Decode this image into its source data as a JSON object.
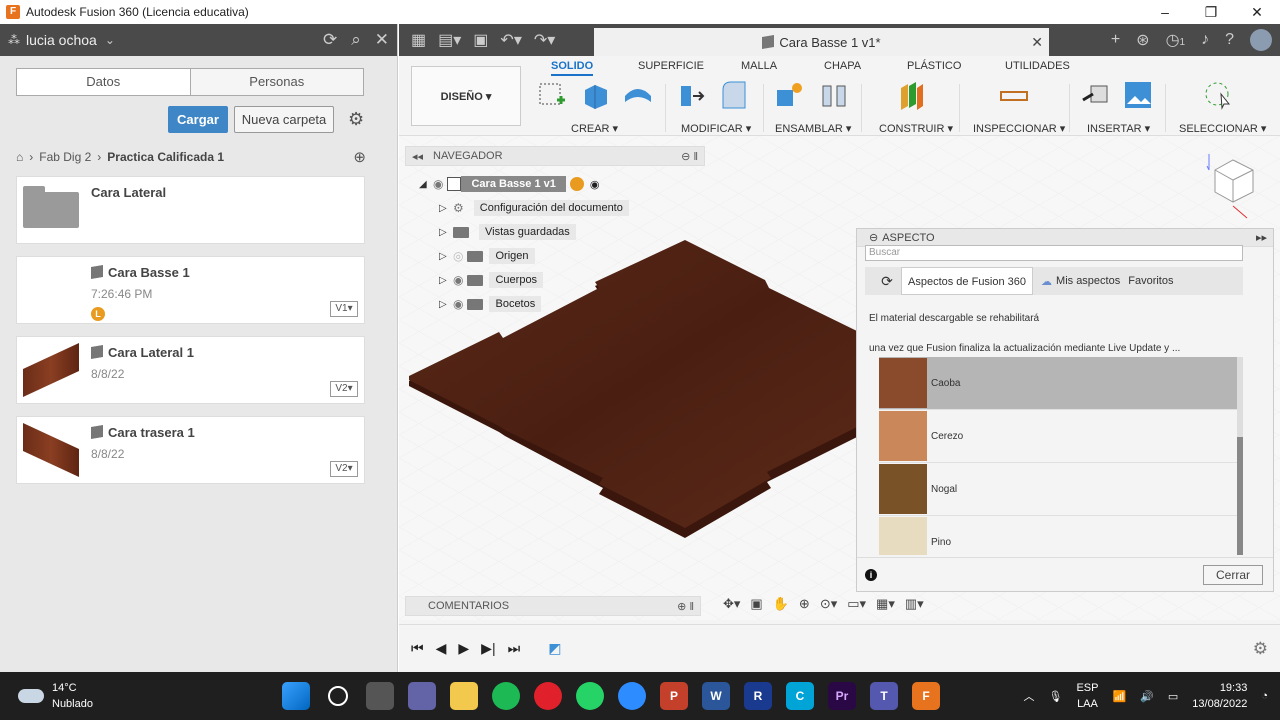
{
  "window": {
    "title": "Autodesk Fusion 360 (Licencia educativa)"
  },
  "left": {
    "user": "lucia ochoa",
    "tabs": [
      "Datos",
      "Personas"
    ],
    "buttons": {
      "upload": "Cargar",
      "new_folder": "Nueva carpeta"
    },
    "breadcrumb": {
      "project": "Fab Dig 2",
      "folder": "Practica Calificada 1"
    },
    "items": [
      {
        "name": "Cara Lateral",
        "sub": "",
        "version": ""
      },
      {
        "name": "Cara Basse 1",
        "sub": "7:26:46 PM",
        "version": "V1▾"
      },
      {
        "name": "Cara Lateral 1",
        "sub": "8/8/22",
        "version": "V2▾"
      },
      {
        "name": "Cara trasera 1",
        "sub": "8/8/22",
        "version": "V2▾"
      }
    ]
  },
  "main": {
    "doc_tab": "Cara Basse 1 v1*",
    "badge": "1",
    "workspace": "DISEÑO ▾",
    "tabs": [
      "SOLIDO",
      "SUPERFICIE",
      "MALLA",
      "CHAPA",
      "PLÁSTICO",
      "UTILIDADES"
    ],
    "groups": [
      "CREAR ▾",
      "MODIFICAR ▾",
      "ENSAMBLAR ▾",
      "CONSTRUIR ▾",
      "INSPECCIONAR ▾",
      "INSERTAR ▾",
      "SELECCIONAR ▾"
    ],
    "navigator": {
      "title": "NAVEGADOR",
      "root": "Cara Basse 1 v1",
      "rows": [
        "Configuración del documento",
        "Vistas guardadas",
        "Origen",
        "Cuerpos",
        "Bocetos"
      ]
    },
    "appearance": {
      "title": "ASPECTO",
      "search": "Buscar",
      "tabs": [
        "Aspectos de Fusion 360",
        "Mis aspectos",
        "Favoritos"
      ],
      "msg1": "El material descargable se rehabilitará",
      "msg2": "una vez que Fusion finaliza la actualización mediante Live Update y ...",
      "materials": [
        {
          "name": "Caoba",
          "color": "#8a4a2c"
        },
        {
          "name": "Cerezo",
          "color": "#c9875a"
        },
        {
          "name": "Nogal",
          "color": "#7a5228"
        },
        {
          "name": "Pino",
          "color": "#e8dcc0"
        }
      ],
      "close": "Cerrar"
    },
    "comments": "COMENTARIOS"
  },
  "taskbar": {
    "temp": "14°C",
    "weather": "Nublado",
    "lang1": "ESP",
    "lang2": "LAA",
    "time": "19:33",
    "date": "13/08/2022"
  }
}
